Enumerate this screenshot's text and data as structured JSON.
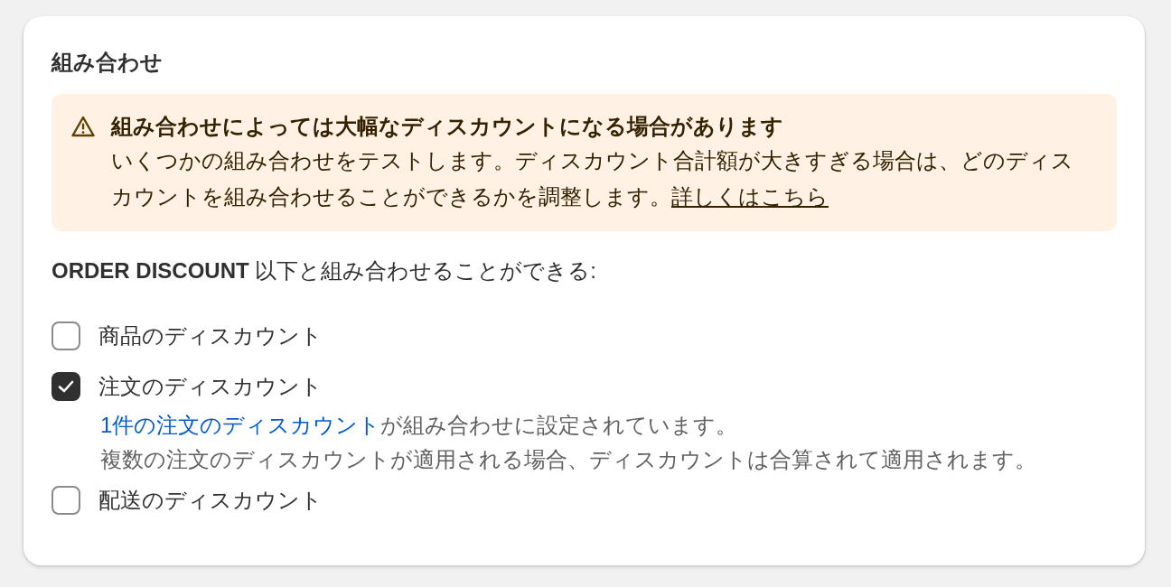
{
  "section": {
    "title": "組み合わせ"
  },
  "banner": {
    "title": "組み合わせによっては大幅なディスカウントになる場合があります",
    "body": "いくつかの組み合わせをテストします。ディスカウント合計額が大きすぎる場合は、どのディスカウントを組み合わせることができるかを調整します。",
    "link": "詳しくはこちら"
  },
  "combine_label": {
    "name": "ORDER DISCOUNT",
    "text": " 以下と組み合わせることができる:"
  },
  "options": [
    {
      "label": "商品のディスカウント",
      "checked": false
    },
    {
      "label": "注文のディスカウント",
      "checked": true,
      "note": {
        "link": "1件の注文のディスカウント",
        "text": "が組み合わせに設定されています。",
        "detail": "複数の注文のディスカウントが適用される場合、ディスカウントは合算されて適用されます。"
      }
    },
    {
      "label": "配送のディスカウント",
      "checked": false
    }
  ]
}
